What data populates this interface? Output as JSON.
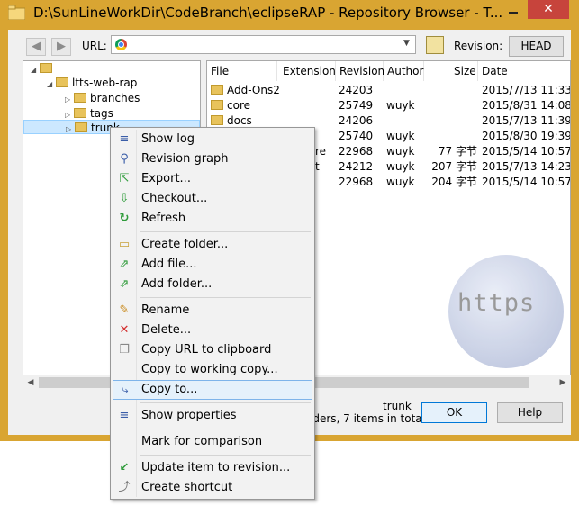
{
  "window": {
    "title": "D:\\SunLineWorkDir\\CodeBranch\\eclipseRAP - Repository Browser - T...",
    "close_glyph": "✕"
  },
  "toolbar": {
    "back_glyph": "◀",
    "forward_glyph": "▶",
    "url_label": "URL:",
    "url_value": "",
    "revision_label": "Revision:",
    "head_button": "HEAD"
  },
  "tree": {
    "items": [
      {
        "label": "ltts-web-rap"
      },
      {
        "label": "branches"
      },
      {
        "label": "tags"
      },
      {
        "label": "trunk"
      }
    ]
  },
  "list": {
    "headers": [
      "File",
      "Extension",
      "Revision",
      "Author",
      "Size",
      "Date"
    ],
    "rows": [
      {
        "file": "Add-Ons2",
        "ext": "",
        "rev": "24203",
        "author": "",
        "size": "",
        "date": "2015/7/13 11:33:2"
      },
      {
        "file": "core",
        "ext": "",
        "rev": "25749",
        "author": "wuyk",
        "size": "",
        "date": "2015/8/31 14:08:3"
      },
      {
        "file": "docs",
        "ext": "",
        "rev": "24206",
        "author": "",
        "size": "",
        "date": "2015/7/13 11:39:2"
      },
      {
        "file": "",
        "ext": "",
        "rev": "25740",
        "author": "wuyk",
        "size": "",
        "date": "2015/8/30 19:39:1"
      },
      {
        "file": "",
        "ext": "re",
        "rev": "22968",
        "author": "wuyk",
        "size": "77 字节",
        "date": "2015/5/14 10:57:1"
      },
      {
        "file": "",
        "ext": "t",
        "rev": "24212",
        "author": "wuyk",
        "size": "207 字节",
        "date": "2015/7/13 14:23:1"
      },
      {
        "file": "",
        "ext": "",
        "rev": "22968",
        "author": "wuyk",
        "size": "204 字节",
        "date": "2015/5/14 10:57:1"
      }
    ]
  },
  "status": {
    "line1": "trunk",
    "line2": "lders, 7 items in total"
  },
  "buttons": {
    "ok": "OK",
    "help": "Help"
  },
  "watermark": "https",
  "context_menu": {
    "items": [
      {
        "label": "Show log",
        "icon": "show-log-icon",
        "glyph": "≡"
      },
      {
        "label": "Revision graph",
        "icon": "revision-graph-icon",
        "glyph": "⚲"
      },
      {
        "label": "Export...",
        "icon": "export-icon",
        "glyph": "⇱"
      },
      {
        "label": "Checkout...",
        "icon": "checkout-icon",
        "glyph": "⇩"
      },
      {
        "label": "Refresh",
        "icon": "refresh-icon",
        "glyph": "↻"
      },
      {
        "label": "Create folder...",
        "icon": "create-folder-icon",
        "glyph": "▭"
      },
      {
        "label": "Add file...",
        "icon": "add-file-icon",
        "glyph": "⇗"
      },
      {
        "label": "Add folder...",
        "icon": "add-folder-icon",
        "glyph": "⇗"
      },
      {
        "label": "Rename",
        "icon": "rename-icon",
        "glyph": "✎"
      },
      {
        "label": "Delete...",
        "icon": "delete-icon",
        "glyph": "✕"
      },
      {
        "label": "Copy URL to clipboard",
        "icon": "copy-url-icon",
        "glyph": "❐"
      },
      {
        "label": "Copy to working copy...",
        "icon": "",
        "glyph": ""
      },
      {
        "label": "Copy to...",
        "icon": "copy-to-icon",
        "glyph": "⤷"
      },
      {
        "label": "Show properties",
        "icon": "properties-icon",
        "glyph": "≡"
      },
      {
        "label": "Mark for comparison",
        "icon": "",
        "glyph": ""
      },
      {
        "label": "Update item to revision...",
        "icon": "update-icon",
        "glyph": "↙"
      },
      {
        "label": "Create shortcut",
        "icon": "shortcut-icon",
        "glyph": "⤴"
      }
    ]
  },
  "colors": {
    "frame": "#d9a532",
    "selection": "#cce8ff",
    "menu_highlight": "#e5f1fb",
    "delete_red": "#d32f2f",
    "green": "#2e9b3a"
  }
}
